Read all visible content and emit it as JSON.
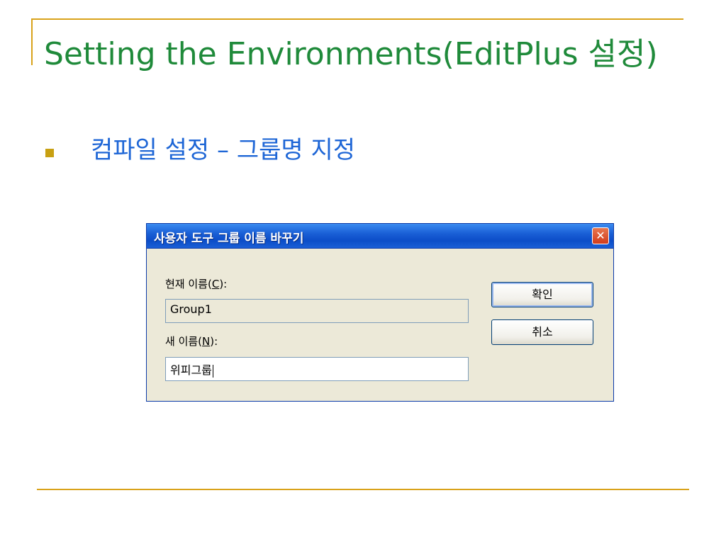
{
  "slide": {
    "title": "Setting the Environments(EditPlus 설정)",
    "bullet": "컴파일 설정 – 그룹명 지정"
  },
  "dialog": {
    "title": "사용자 도구 그룹 이름 바꾸기",
    "close_icon": "close-icon",
    "current_name_label_prefix": "현재 이름(",
    "current_name_label_key": "C",
    "current_name_label_suffix": "):",
    "current_name_value": "Group1",
    "new_name_label_prefix": "새 이름(",
    "new_name_label_key": "N",
    "new_name_label_suffix": "):",
    "new_name_value": "위피그룹",
    "ok_button": "확인",
    "cancel_button": "취소"
  },
  "colors": {
    "accent_rule": "#d9a21a",
    "title_green": "#1f8a3a",
    "bullet_blue": "#1e66d6"
  }
}
